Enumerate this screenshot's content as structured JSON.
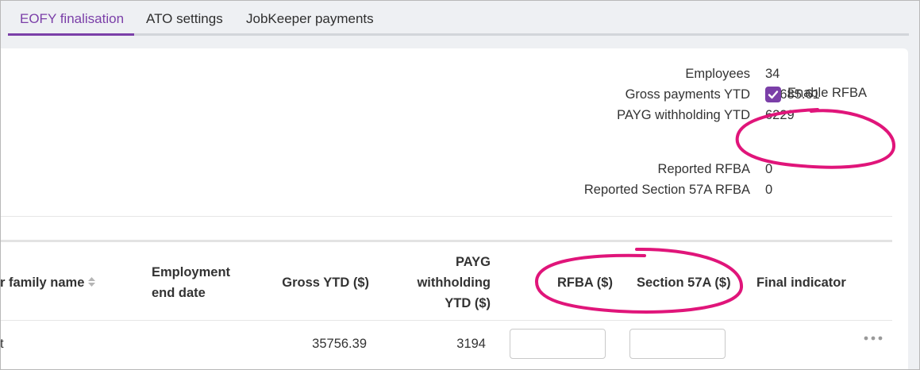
{
  "tabs": [
    {
      "label": "EOFY finalisation",
      "active": true
    },
    {
      "label": "ATO settings",
      "active": false
    },
    {
      "label": "JobKeeper payments",
      "active": false
    }
  ],
  "summary": {
    "employees_label": "Employees",
    "employees_value": "34",
    "gross_label": "Gross payments YTD",
    "gross_value": "92685.61",
    "payg_label": "PAYG withholding YTD",
    "payg_value": "6229",
    "enable_rfba_label": "Enable RFBA",
    "enable_rfba_checked": true,
    "reported_rfba_label": "Reported RFBA",
    "reported_rfba_value": "0",
    "reported_57a_label": "Reported Section 57A RFBA",
    "reported_57a_value": "0"
  },
  "table": {
    "headers": {
      "family_name": "r family name",
      "employment_end_date": [
        "Employment",
        "end date"
      ],
      "gross_ytd": "Gross YTD ($)",
      "payg_ytd": [
        "PAYG",
        "withholding",
        "YTD ($)"
      ],
      "rfba": "RFBA ($)",
      "section57a": "Section 57A ($)",
      "final_indicator": "Final indicator"
    },
    "rows": [
      {
        "family_name": "t",
        "employment_end_date": "",
        "gross_ytd": "35756.39",
        "payg_ytd": "3194",
        "rfba": "",
        "section57a": ""
      }
    ]
  },
  "colors": {
    "accent": "#7b3fa8",
    "annotation": "#e0157a"
  },
  "icons": [
    "sort-icon",
    "check-icon",
    "more-icon"
  ]
}
